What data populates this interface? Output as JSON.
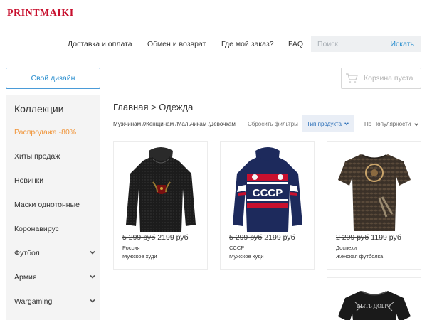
{
  "logo": "PRINTMAIKI",
  "nav": {
    "delivery": "Доставка и оплата",
    "exchange": "Обмен и возврат",
    "where": "Где мой заказ?",
    "faq": "FAQ"
  },
  "search": {
    "placeholder": "Поиск",
    "button": "Искать"
  },
  "own_design": "Свой дизайн",
  "cart": {
    "label": "Корзина пуста",
    "icon": "cart-icon"
  },
  "sidebar": {
    "title": "Коллекции",
    "items": [
      {
        "label": "Распродажа -80%",
        "accent": "#f0953a"
      },
      {
        "label": "Хиты продаж"
      },
      {
        "label": "Новинки"
      },
      {
        "label": "Маски однотонные"
      },
      {
        "label": "Коронавирус"
      },
      {
        "label": "Футбол",
        "expandable": true
      },
      {
        "label": "Армия",
        "expandable": true
      },
      {
        "label": "Wargaming",
        "expandable": true
      }
    ]
  },
  "breadcrumb": "Главная > Одежда",
  "filters": {
    "gender": "Мужчинам /Женщинам /Мальчикам /Девочкам",
    "reset": "Сбросить фильтры",
    "type": "Тип продукта",
    "sort": "По Популярности"
  },
  "products": [
    {
      "old_price": "5 299 руб",
      "price": "2199 руб",
      "name": "Россия",
      "kind": "Мужское худи"
    },
    {
      "old_price": "5 299 руб",
      "price": "2199 руб",
      "name": "СССР",
      "kind": "Мужское худи",
      "print": "CCCP"
    },
    {
      "old_price": "2 299 руб",
      "price": "1199 руб",
      "name": "Доспехи",
      "kind": "Женская футболка"
    },
    {
      "print": "БЫТЬ ДОБРУ"
    }
  ],
  "colors": {
    "logo": "#c8102e",
    "link": "#2b8fcf",
    "sale": "#f0953a"
  }
}
